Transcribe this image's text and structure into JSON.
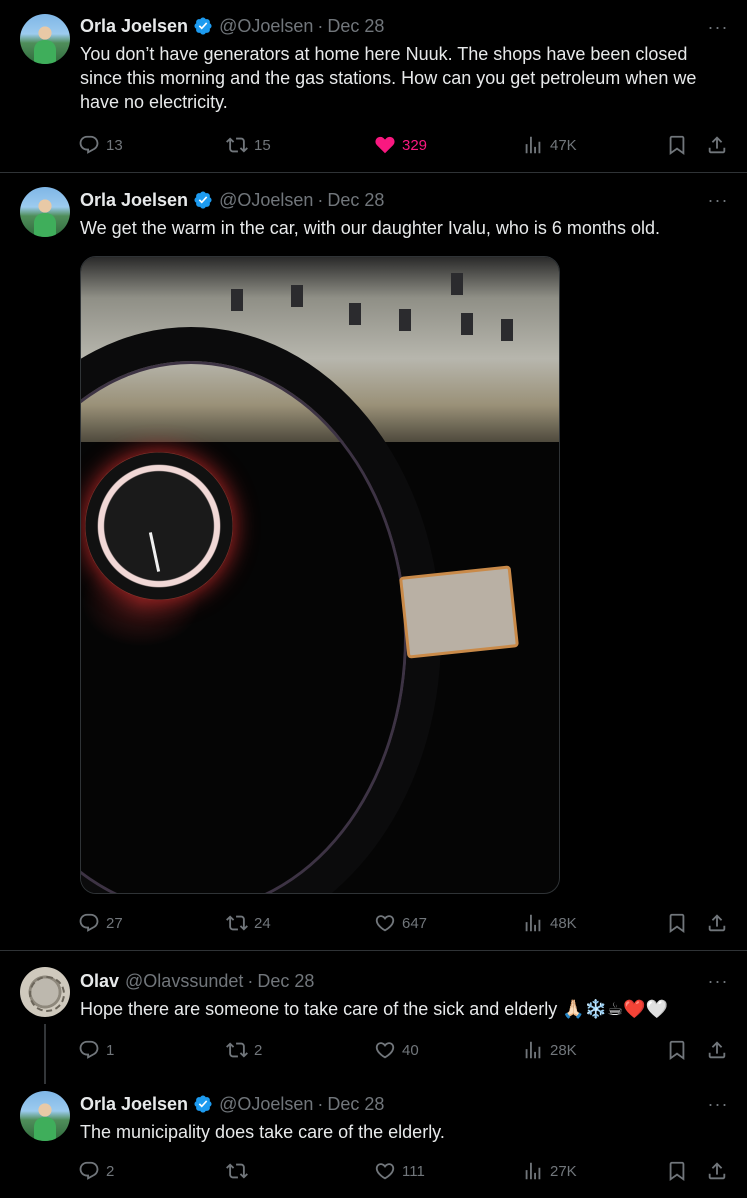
{
  "tweets": [
    {
      "name": "Orla Joelsen",
      "handle": "@OJoelsen",
      "date": "Dec 28",
      "text": "You don’t have generators at home here Nuuk. The shops have been closed since this morning and the  gas stations. How can you get petroleum when we have no electricity.",
      "replies": "13",
      "reposts": "15",
      "likes": "329",
      "liked": true,
      "views": "47K"
    },
    {
      "name": "Orla Joelsen",
      "handle": "@OJoelsen",
      "date": "Dec 28",
      "text": "We get the warm in the car, with our daughter Ivalu, who is 6 months old.",
      "replies": "27",
      "reposts": "24",
      "likes": "647",
      "views": "48K"
    },
    {
      "name": "Olav",
      "handle": "@Olavssundet",
      "date": "Dec 28",
      "text": "Hope there are someone to take  care of the sick and elderly 🙏🏻❄️☕❤️🤍",
      "replies": "1",
      "reposts": "2",
      "likes": "40",
      "views": "28K"
    },
    {
      "name": "Orla Joelsen",
      "handle": "@OJoelsen",
      "date": "Dec 28",
      "text": "The municipality does take care of the elderly.",
      "replies": "2",
      "reposts": "",
      "likes": "111",
      "views": "27K"
    }
  ],
  "separator": "·",
  "more_glyph": "···",
  "colors": {
    "accent_like": "#f91880",
    "verified": "#1d9bf0",
    "muted": "#71767b"
  }
}
